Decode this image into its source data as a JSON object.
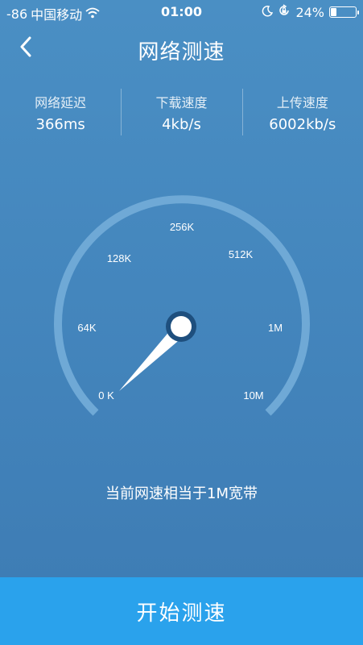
{
  "status_bar": {
    "signal": "-86",
    "carrier": "中国移动",
    "time": "01:00",
    "battery_percent": "24%",
    "battery_level": 0.24,
    "icons": [
      "wifi-icon",
      "moon-icon",
      "rotation-lock-icon",
      "battery-icon"
    ]
  },
  "header": {
    "title": "网络测速",
    "back_icon": "chevron-left-icon"
  },
  "stats": [
    {
      "label": "网络延迟",
      "value": "366ms"
    },
    {
      "label": "下载速度",
      "value": "4kb/s"
    },
    {
      "label": "上传速度",
      "value": "6002kb/s"
    }
  ],
  "gauge": {
    "labels": [
      "0 K",
      "64K",
      "128K",
      "256K",
      "512K",
      "1M",
      "10M"
    ],
    "needle_reading": "0 K",
    "colors": {
      "arc": "#6fa9d6",
      "needle": "#ffffff",
      "hub_ring": "#1e4f7e"
    }
  },
  "result_text": "当前网速相当于1M宽带",
  "start_button": {
    "label": "开始测速",
    "color": "#2aa2ec"
  }
}
